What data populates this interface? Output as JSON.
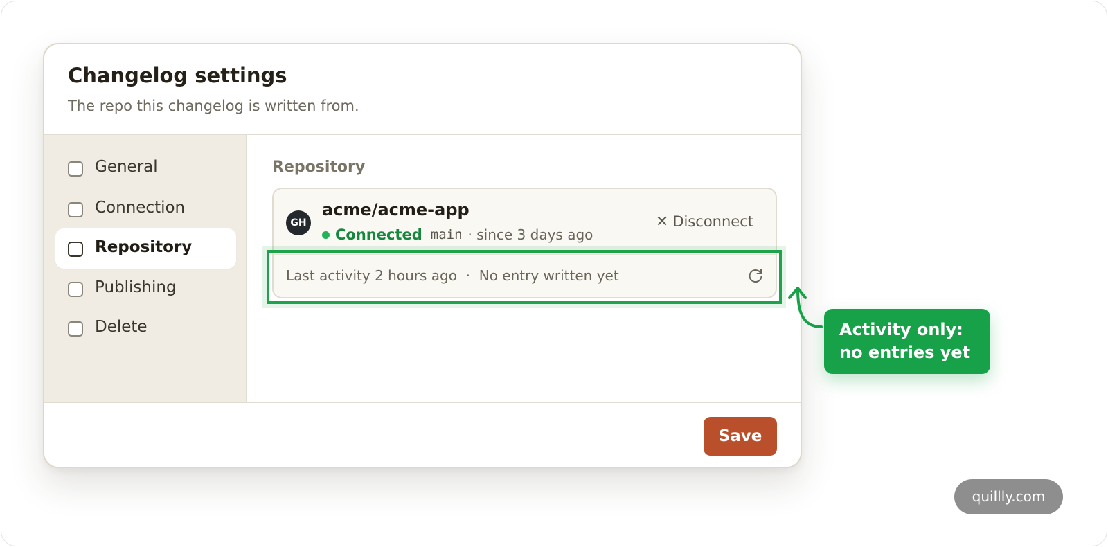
{
  "dialog": {
    "title": "Changelog settings",
    "subtitle": "The repo this changelog is written from."
  },
  "sidebar": {
    "items": [
      {
        "label": "General",
        "active": false
      },
      {
        "label": "Connection",
        "active": false
      },
      {
        "label": "Repository",
        "active": true
      },
      {
        "label": "Publishing",
        "active": false
      },
      {
        "label": "Delete",
        "active": false
      }
    ]
  },
  "repository": {
    "section_title": "Repository",
    "avatar_text": "GH",
    "name": "acme/acme-app",
    "status": "Connected",
    "branch": "main",
    "since": "· since 3 days ago",
    "disconnect_label": "Disconnect",
    "activity_text": "Last activity 2 hours ago  ·  No entry written yet"
  },
  "footer": {
    "save_label": "Save"
  },
  "annotation": {
    "line1": "Activity only:",
    "line2": "no entries yet"
  },
  "watermark": "quillly.com",
  "colors": {
    "accent": "#b9502b",
    "connected": "#17873f",
    "annotation": "#17a148"
  },
  "icons": [
    "github-avatar",
    "close-icon",
    "refresh-icon",
    "checkbox-icon"
  ]
}
